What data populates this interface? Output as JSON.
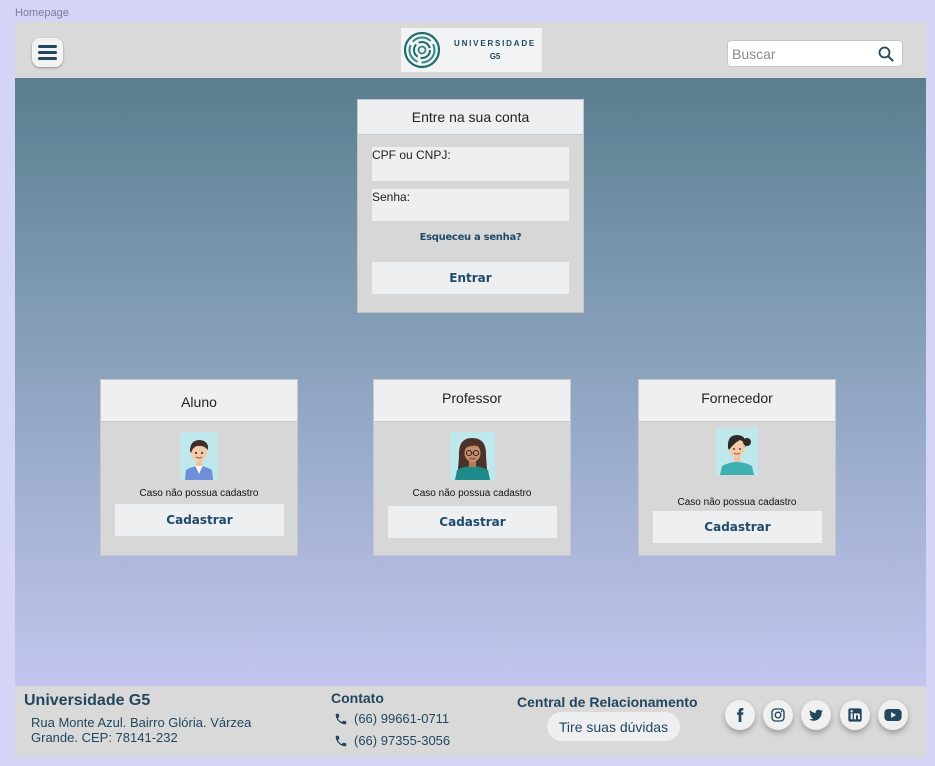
{
  "page_label": "Homepage",
  "header": {
    "menu_icon": "hamburger-menu-icon",
    "logo": {
      "line1": "UNIVERSIDADE",
      "line2": "G5",
      "mark_color": "#1f6b6b"
    },
    "search": {
      "placeholder": "Buscar",
      "icon": "search-icon"
    }
  },
  "login": {
    "title": "Entre na sua conta",
    "cpf_label": "CPF ou CNPJ:",
    "password_label": "Senha:",
    "forgot": "Esqueceu a senha?",
    "enter": "Entrar"
  },
  "cards": [
    {
      "title": "Aluno",
      "note": "Caso não possua cadastro",
      "button": "Cadastrar",
      "avatar": "student-avatar-icon"
    },
    {
      "title": "Professor",
      "note": "Caso não possua cadastro",
      "button": "Cadastrar",
      "avatar": "teacher-avatar-icon"
    },
    {
      "title": "Fornecedor",
      "note": "Caso não possua cadastro",
      "button": "Cadastrar",
      "avatar": "supplier-avatar-icon"
    }
  ],
  "footer": {
    "university": "Universidade G5",
    "address": "Rua Monte Azul. Bairro Glória. Várzea Grande. CEP: 78141-232",
    "contact_title": "Contato",
    "phones": [
      "(66) 99661-0711",
      "(66) 97355-3056"
    ],
    "central_title": "Central de Relacionamento",
    "doubts_button": "Tire suas dúvidas",
    "social": [
      "facebook-icon",
      "instagram-icon",
      "twitter-icon",
      "linkedin-icon",
      "youtube-icon"
    ]
  },
  "colors": {
    "primary_text": "#22475e",
    "accent": "#1f4a6b",
    "background": "#d4d4f7"
  }
}
